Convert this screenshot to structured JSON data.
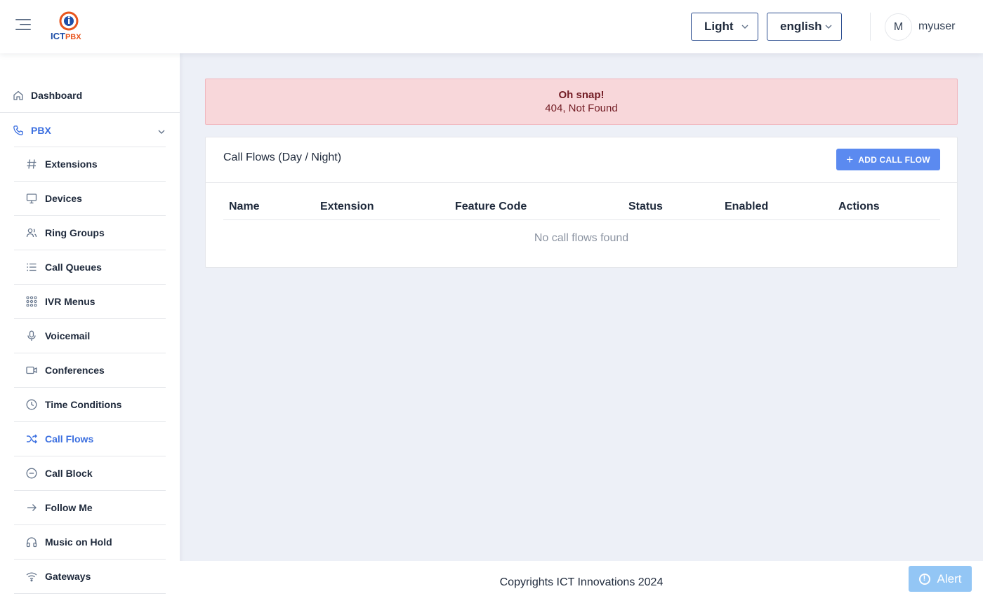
{
  "header": {
    "logo_ict": "ICT",
    "logo_pbx": "PBX",
    "theme_select": "Light",
    "lang_select": "english",
    "avatar_initial": "M",
    "username": "myuser"
  },
  "sidebar": {
    "dashboard": {
      "label": "Dashboard",
      "icon": "home-icon"
    },
    "pbx": {
      "label": "PBX",
      "icon": "phone-icon"
    },
    "items": [
      {
        "label": "Extensions",
        "icon": "hash-icon"
      },
      {
        "label": "Devices",
        "icon": "monitor-icon"
      },
      {
        "label": "Ring Groups",
        "icon": "users-icon"
      },
      {
        "label": "Call Queues",
        "icon": "list-icon"
      },
      {
        "label": "IVR Menus",
        "icon": "grid-icon"
      },
      {
        "label": "Voicemail",
        "icon": "mic-icon"
      },
      {
        "label": "Conferences",
        "icon": "video-icon"
      },
      {
        "label": "Time Conditions",
        "icon": "clock-icon"
      },
      {
        "label": "Call Flows",
        "icon": "shuffle-icon",
        "active": true
      },
      {
        "label": "Call Block",
        "icon": "minus-circle-icon"
      },
      {
        "label": "Follow Me",
        "icon": "arrow-right-icon"
      },
      {
        "label": "Music on Hold",
        "icon": "headphones-icon"
      },
      {
        "label": "Gateways",
        "icon": "wifi-icon"
      }
    ]
  },
  "alert": {
    "title": "Oh snap!",
    "message": "404, Not Found"
  },
  "card": {
    "title": "Call Flows (Day / Night)",
    "add_button": "ADD CALL FLOW",
    "columns": [
      "Name",
      "Extension",
      "Feature Code",
      "Status",
      "Enabled",
      "Actions"
    ],
    "empty_message": "No call flows found"
  },
  "footer": {
    "copyright": "Copyrights ICT Innovations 2024",
    "alert_button": "Alert"
  },
  "colors": {
    "accent": "#3b6fe0",
    "button": "#5b8af0",
    "alert_bg": "#f8d7da",
    "alert_text": "#721c24",
    "float_alert": "#93c6f5"
  }
}
